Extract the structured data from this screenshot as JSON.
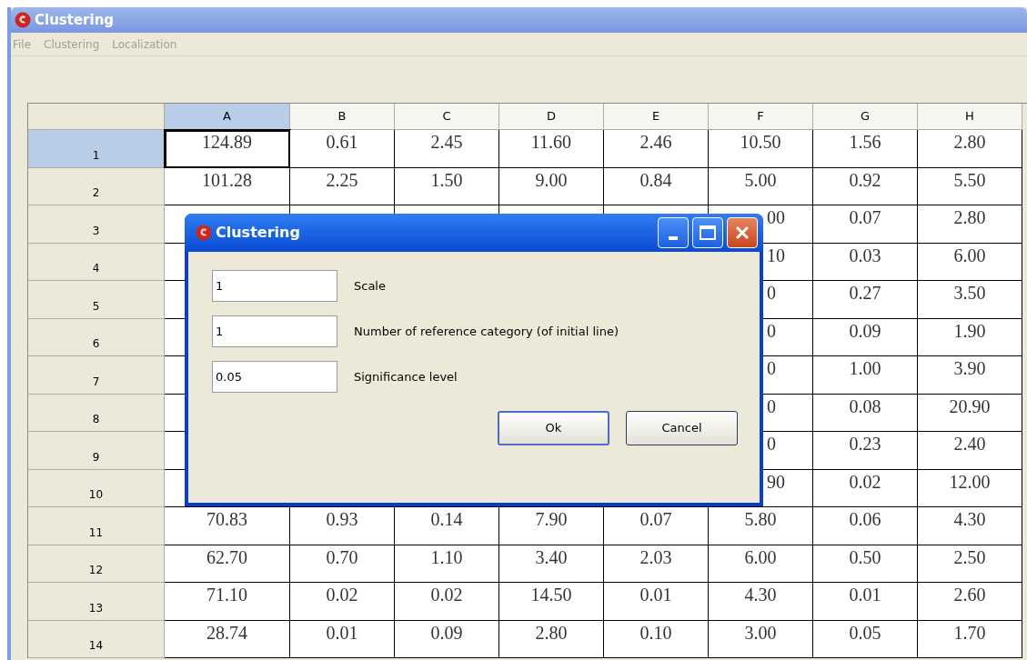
{
  "window": {
    "title": "Clustering"
  },
  "menu": [
    "File",
    "Clustering",
    "Localization"
  ],
  "table": {
    "columns": [
      {
        "label": "A",
        "selected": true
      },
      {
        "label": "B",
        "selected": false
      },
      {
        "label": "C",
        "selected": false
      },
      {
        "label": "D",
        "selected": false
      },
      {
        "label": "E",
        "selected": false
      },
      {
        "label": "F",
        "selected": false
      },
      {
        "label": "G",
        "selected": false
      },
      {
        "label": "H",
        "selected": false
      }
    ],
    "rows": [
      {
        "header": "1",
        "selected": true,
        "cells": [
          "124.89",
          "0.61",
          "2.45",
          "11.60",
          "2.46",
          "10.50",
          "1.56",
          "2.80"
        ]
      },
      {
        "header": "2",
        "selected": false,
        "cells": [
          "101.28",
          "2.25",
          "1.50",
          "9.00",
          "0.84",
          "5.00",
          "0.92",
          "5.50"
        ]
      },
      {
        "header": "3",
        "selected": false,
        "cells": [
          null,
          null,
          null,
          null,
          null,
          "00",
          "0.07",
          "2.80"
        ]
      },
      {
        "header": "4",
        "selected": false,
        "cells": [
          null,
          null,
          null,
          null,
          null,
          "10",
          "0.03",
          "6.00"
        ]
      },
      {
        "header": "5",
        "selected": false,
        "cells": [
          null,
          null,
          null,
          null,
          null,
          "0",
          "0.27",
          "3.50"
        ]
      },
      {
        "header": "6",
        "selected": false,
        "cells": [
          null,
          null,
          null,
          null,
          null,
          "0",
          "0.09",
          "1.90"
        ]
      },
      {
        "header": "7",
        "selected": false,
        "cells": [
          null,
          null,
          null,
          null,
          null,
          "0",
          "1.00",
          "3.90"
        ]
      },
      {
        "header": "8",
        "selected": false,
        "cells": [
          null,
          null,
          null,
          null,
          null,
          "0",
          "0.08",
          "20.90"
        ]
      },
      {
        "header": "9",
        "selected": false,
        "cells": [
          null,
          null,
          null,
          null,
          null,
          "0",
          "0.23",
          "2.40"
        ]
      },
      {
        "header": "10",
        "selected": false,
        "cells": [
          null,
          null,
          null,
          null,
          null,
          "90",
          "0.02",
          "12.00"
        ]
      },
      {
        "header": "11",
        "selected": false,
        "cells": [
          "70.83",
          "0.93",
          "0.14",
          "7.90",
          "0.07",
          "5.80",
          "0.06",
          "4.30"
        ]
      },
      {
        "header": "12",
        "selected": false,
        "cells": [
          "62.70",
          "0.70",
          "1.10",
          "3.40",
          "2.03",
          "6.00",
          "0.50",
          "2.50"
        ]
      },
      {
        "header": "13",
        "selected": false,
        "cells": [
          "71.10",
          "0.02",
          "0.02",
          "14.50",
          "0.01",
          "4.30",
          "0.01",
          "2.60"
        ]
      },
      {
        "header": "14",
        "selected": false,
        "cells": [
          "28.74",
          "0.01",
          "0.09",
          "2.80",
          "0.10",
          "3.00",
          "0.05",
          "1.70"
        ]
      }
    ]
  },
  "dialog": {
    "title": "Clustering",
    "fields": [
      {
        "value": "1",
        "label": "Scale"
      },
      {
        "value": "1",
        "label": "Number of reference category (of initial line)"
      },
      {
        "value": "0.05",
        "label": "Significance level"
      }
    ],
    "buttons": [
      "Ok",
      "Cancel"
    ]
  }
}
